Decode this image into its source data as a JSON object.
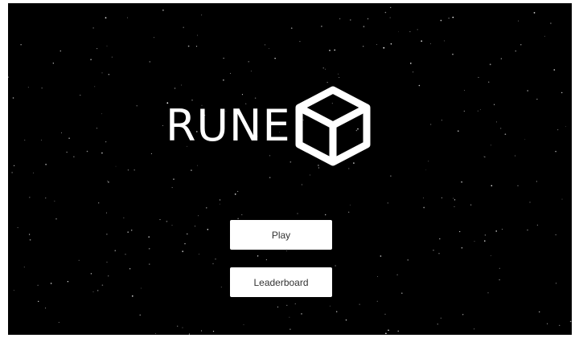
{
  "game": {
    "title": "RUNE",
    "logo_icon": "cube-icon",
    "background_color": "#000000",
    "star_color": "#ffffff"
  },
  "menu": {
    "play_label": "Play",
    "leaderboard_label": "Leaderboard"
  }
}
